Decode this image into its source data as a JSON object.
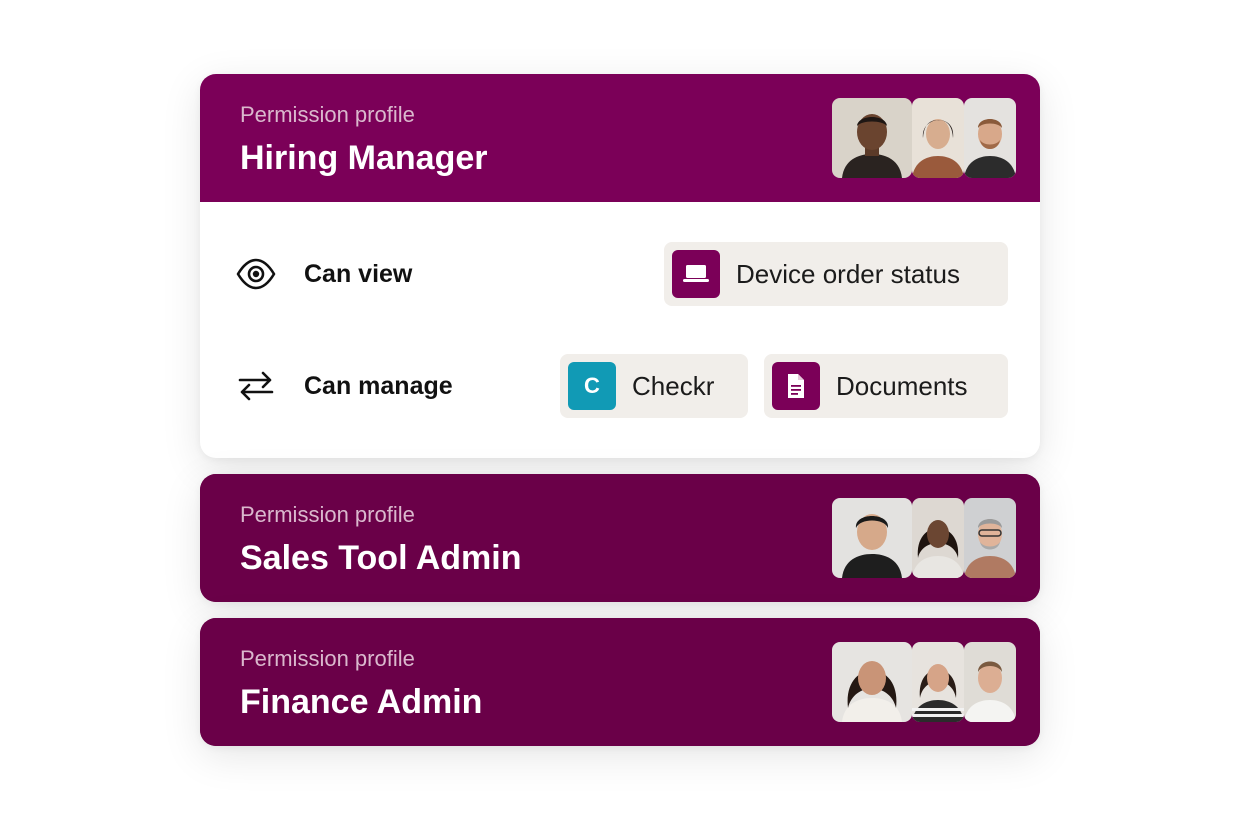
{
  "profiles": [
    {
      "subtitle": "Permission profile",
      "title": "Hiring Manager",
      "expanded": true,
      "permissions": {
        "view_label": "Can view",
        "view_items": [
          {
            "label": "Device order status",
            "icon": "laptop-icon"
          }
        ],
        "manage_label": "Can manage",
        "manage_items": [
          {
            "label": "Checkr",
            "icon": "checkr-logo-icon",
            "icon_letter": "C"
          },
          {
            "label": "Documents",
            "icon": "document-icon"
          }
        ]
      }
    },
    {
      "subtitle": "Permission profile",
      "title": "Sales Tool Admin",
      "expanded": false
    },
    {
      "subtitle": "Permission profile",
      "title": "Finance Admin",
      "expanded": false
    }
  ],
  "colors": {
    "header_plum": "#7b0058",
    "collapsed_plum": "#6a0048",
    "chip_bg": "#f1eeea",
    "checkr_teal": "#119ab5"
  }
}
